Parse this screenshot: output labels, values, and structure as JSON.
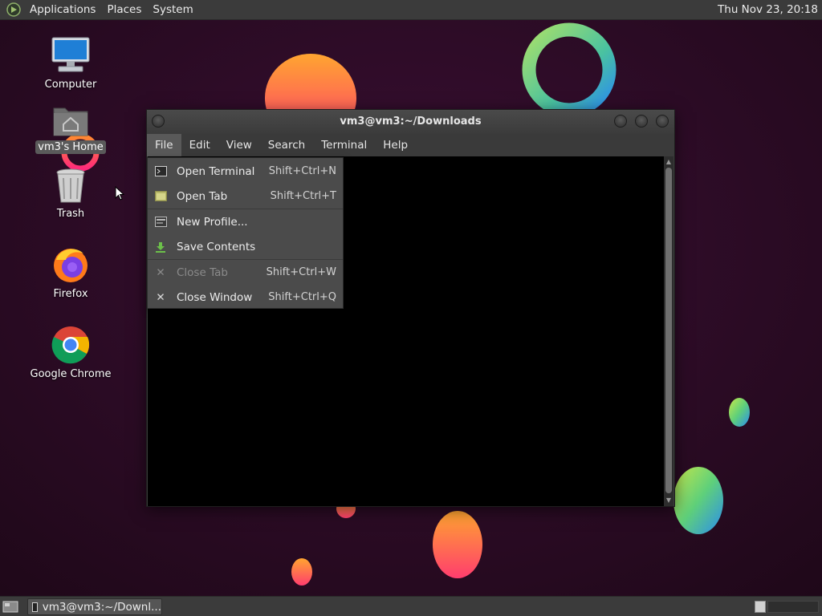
{
  "top_panel": {
    "menus": [
      "Applications",
      "Places",
      "System"
    ],
    "clock": "Thu Nov 23, 20:18"
  },
  "desktop_icons": {
    "computer": "Computer",
    "home": "vm3's Home",
    "trash": "Trash",
    "firefox": "Firefox",
    "chrome": "Google Chrome"
  },
  "terminal": {
    "title": "vm3@vm3:~/Downloads",
    "menubar": [
      "File",
      "Edit",
      "View",
      "Search",
      "Terminal",
      "Help"
    ],
    "active_menu": "File"
  },
  "file_menu": {
    "items": [
      {
        "label": "Open Terminal",
        "accel": "Shift+Ctrl+N",
        "icon": "terminal-icon",
        "enabled": true
      },
      {
        "label": "Open Tab",
        "accel": "Shift+Ctrl+T",
        "icon": "tab-icon",
        "enabled": true
      },
      {
        "label": "New Profile...",
        "accel": "",
        "icon": "profile-icon",
        "enabled": true
      },
      {
        "label": "Save Contents",
        "accel": "",
        "icon": "save-download-icon",
        "enabled": true
      },
      {
        "label": "Close Tab",
        "accel": "Shift+Ctrl+W",
        "icon": "close-icon",
        "enabled": false
      },
      {
        "label": "Close Window",
        "accel": "Shift+Ctrl+Q",
        "icon": "close-icon",
        "enabled": true
      }
    ]
  },
  "bottom_panel": {
    "task_label": "vm3@vm3:~/Downl..."
  },
  "colors": {
    "panel_bg": "#3b3b3b",
    "desktop_bg": "#2a0a24",
    "menu_bg": "#4b4b4b",
    "terminal_bg": "#000000"
  }
}
